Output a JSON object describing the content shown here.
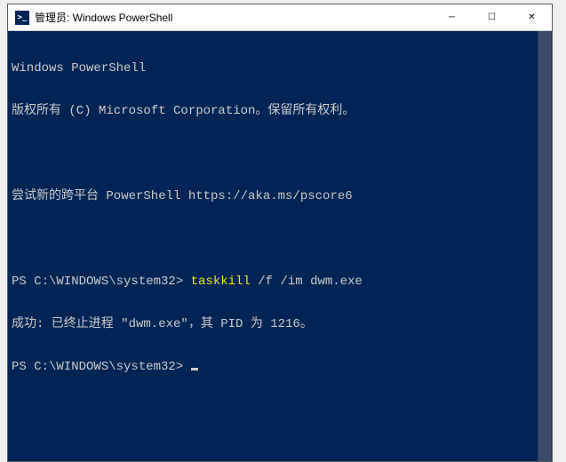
{
  "window": {
    "icon_text": ">_",
    "title": "管理员: Windows PowerShell",
    "controls": {
      "minimize": "─",
      "maximize": "☐",
      "close": "✕"
    }
  },
  "terminal": {
    "line1": "Windows PowerShell",
    "line2": "版权所有 (C) Microsoft Corporation。保留所有权利。",
    "line3": "尝试新的跨平台 PowerShell https://aka.ms/pscore6",
    "prompt1_prefix": "PS C:\\WINDOWS\\system32> ",
    "prompt1_cmd": "taskkill",
    "prompt1_args": " /f /im dwm.exe",
    "line5": "成功: 已终止进程 \"dwm.exe\"，其 PID 为 1216。",
    "prompt2": "PS C:\\WINDOWS\\system32> "
  }
}
